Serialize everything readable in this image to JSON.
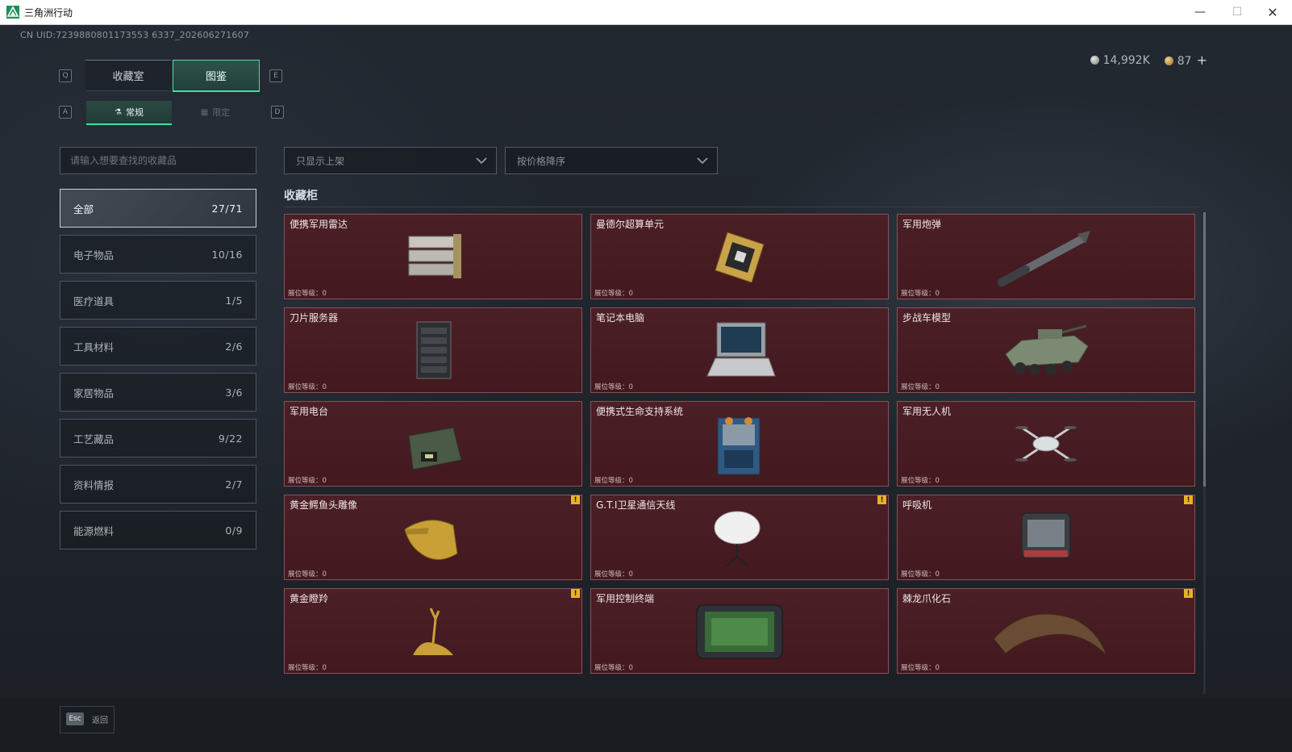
{
  "window": {
    "title": "三角洲行动",
    "minimize": "—",
    "maximize": "☐",
    "close": "✕"
  },
  "uid": "CN UID:7239880801173553 6337_202606271607",
  "currency": {
    "silver": "14,992K",
    "gold": "87",
    "plus": "+"
  },
  "keys": {
    "q": "Q",
    "e": "E",
    "a": "A",
    "d": "D",
    "esc": "Esc"
  },
  "tabs": {
    "collection_room": "收藏室",
    "codex": "图鉴",
    "regular": "常规",
    "limited": "限定"
  },
  "search": {
    "placeholder": "请输入想要查找的收藏品"
  },
  "filters": {
    "show": "只显示上架",
    "sort": "按价格降序"
  },
  "categories": [
    {
      "label": "全部",
      "count": "27/71"
    },
    {
      "label": "电子物品",
      "count": "10/16"
    },
    {
      "label": "医疗道具",
      "count": "1/5"
    },
    {
      "label": "工具材料",
      "count": "2/6"
    },
    {
      "label": "家居物品",
      "count": "3/6"
    },
    {
      "label": "工艺藏品",
      "count": "9/22"
    },
    {
      "label": "资料情报",
      "count": "2/7"
    },
    {
      "label": "能源燃料",
      "count": "0/9"
    }
  ],
  "section_title": "收藏柜",
  "level_label": "展位等级：0",
  "warn_symbol": "!",
  "cards": [
    {
      "name": "便携军用雷达"
    },
    {
      "name": "曼德尔超算单元"
    },
    {
      "name": "军用炮弹"
    },
    {
      "name": "刀片服务器"
    },
    {
      "name": "笔记本电脑"
    },
    {
      "name": "步战车模型"
    },
    {
      "name": "军用电台"
    },
    {
      "name": "便携式生命支持系统"
    },
    {
      "name": "军用无人机"
    },
    {
      "name": "黄金鳄鱼头雕像"
    },
    {
      "name": "G.T.I卫星通信天线"
    },
    {
      "name": "呼吸机"
    },
    {
      "name": "黄金瞪羚"
    },
    {
      "name": "军用控制终端"
    },
    {
      "name": "棘龙爪化石"
    }
  ],
  "footer": {
    "back": "返回"
  },
  "colors": {
    "accent": "#3ee0a0",
    "card_bg": "#4a1f25",
    "warn": "#e6b422"
  }
}
